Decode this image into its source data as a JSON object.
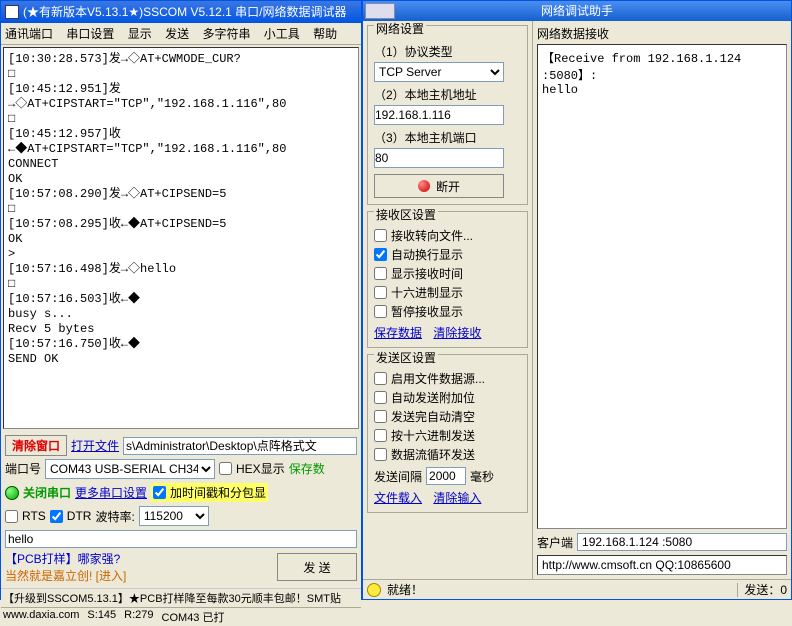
{
  "left": {
    "title": "(★有新版本V5.13.1★)SSCOM V5.12.1 串口/网络数据调试器",
    "menu": [
      "通讯端口",
      "串口设置",
      "显示",
      "发送",
      "多字符串",
      "小工具",
      "帮助"
    ],
    "terminal_lines": [
      "[10:30:28.573]发→◇AT+CWMODE_CUR?",
      "□",
      "",
      "[10:45:12.951]发→◇AT+CIPSTART=\"TCP\",\"192.168.1.116\",80",
      "□",
      "[10:45:12.957]收←◆AT+CIPSTART=\"TCP\",\"192.168.1.116\",80",
      "CONNECT",
      "",
      "OK",
      "",
      "[10:57:08.290]发→◇AT+CIPSEND=5",
      "□",
      "[10:57:08.295]收←◆AT+CIPSEND=5",
      "",
      "OK",
      ">",
      "[10:57:16.498]发→◇hello",
      "□",
      "[10:57:16.503]收←◆",
      "busy s...",
      "",
      "Recv 5 bytes",
      "",
      "[10:57:16.750]收←◆",
      "SEND OK"
    ],
    "clear_btn": "清除窗口",
    "open_file": "打开文件",
    "file_path": "s\\Administrator\\Desktop\\点阵格式文",
    "port_label": "端口号",
    "port_value": "COM43 USB-SERIAL CH340",
    "hex_display": "HEX显示",
    "save_data": "保存数",
    "close_port": "关闭串口",
    "more_settings": "更多串口设置",
    "timestamp_chk": "加时间戳和分包显",
    "rts": "RTS",
    "dtr": "DTR",
    "baud_label": "波特率:",
    "baud_value": "115200",
    "send_text": "hello",
    "pcb_q": "【PCB打样】哪家强?",
    "pcb_a": "当然就是嘉立创! [进入]",
    "send_btn": "发  送",
    "ad1": "【升级到SSCOM5.13.1】★PCB打样降至每款30元顺丰包邮！SMT贴",
    "status_site": "www.daxia.com",
    "status_s": "S:145",
    "status_r": "R:279",
    "status_port": "COM43 已打"
  },
  "right": {
    "title": "网络调试助手",
    "net_settings": "网络设置",
    "proto_label": "（1）协议类型",
    "proto_value": "TCP Server",
    "host_label": "（2）本地主机地址",
    "host_value": "192.168.1.116",
    "port_label": "（3）本地主机端口",
    "port_value": "80",
    "disconnect": "断开",
    "recv_settings": "接收区设置",
    "recv_opts": [
      "接收转向文件...",
      "自动换行显示",
      "显示接收时间",
      "十六进制显示",
      "暂停接收显示"
    ],
    "recv_checked": [
      false,
      true,
      false,
      false,
      false
    ],
    "save_data": "保存数据",
    "clear_recv": "清除接收",
    "send_settings": "发送区设置",
    "send_opts": [
      "启用文件数据源...",
      "自动发送附加位",
      "发送完自动清空",
      "按十六进制发送",
      "数据流循环发送"
    ],
    "send_interval_lbl": "发送间隔",
    "send_interval_val": "2000",
    "send_interval_unit": "毫秒",
    "file_load": "文件载入",
    "clear_input": "清除输入",
    "recv_header": "网络数据接收",
    "recv_line1": "【Receive from 192.168.1.124 :5080】:",
    "recv_line2": "hello",
    "client_label": "客户端",
    "client_value": "192.168.1.124 :5080",
    "send_box": "http://www.cmsoft.cn QQ:10865600",
    "status_ok": "就绪！",
    "status_send": "发送：0"
  }
}
